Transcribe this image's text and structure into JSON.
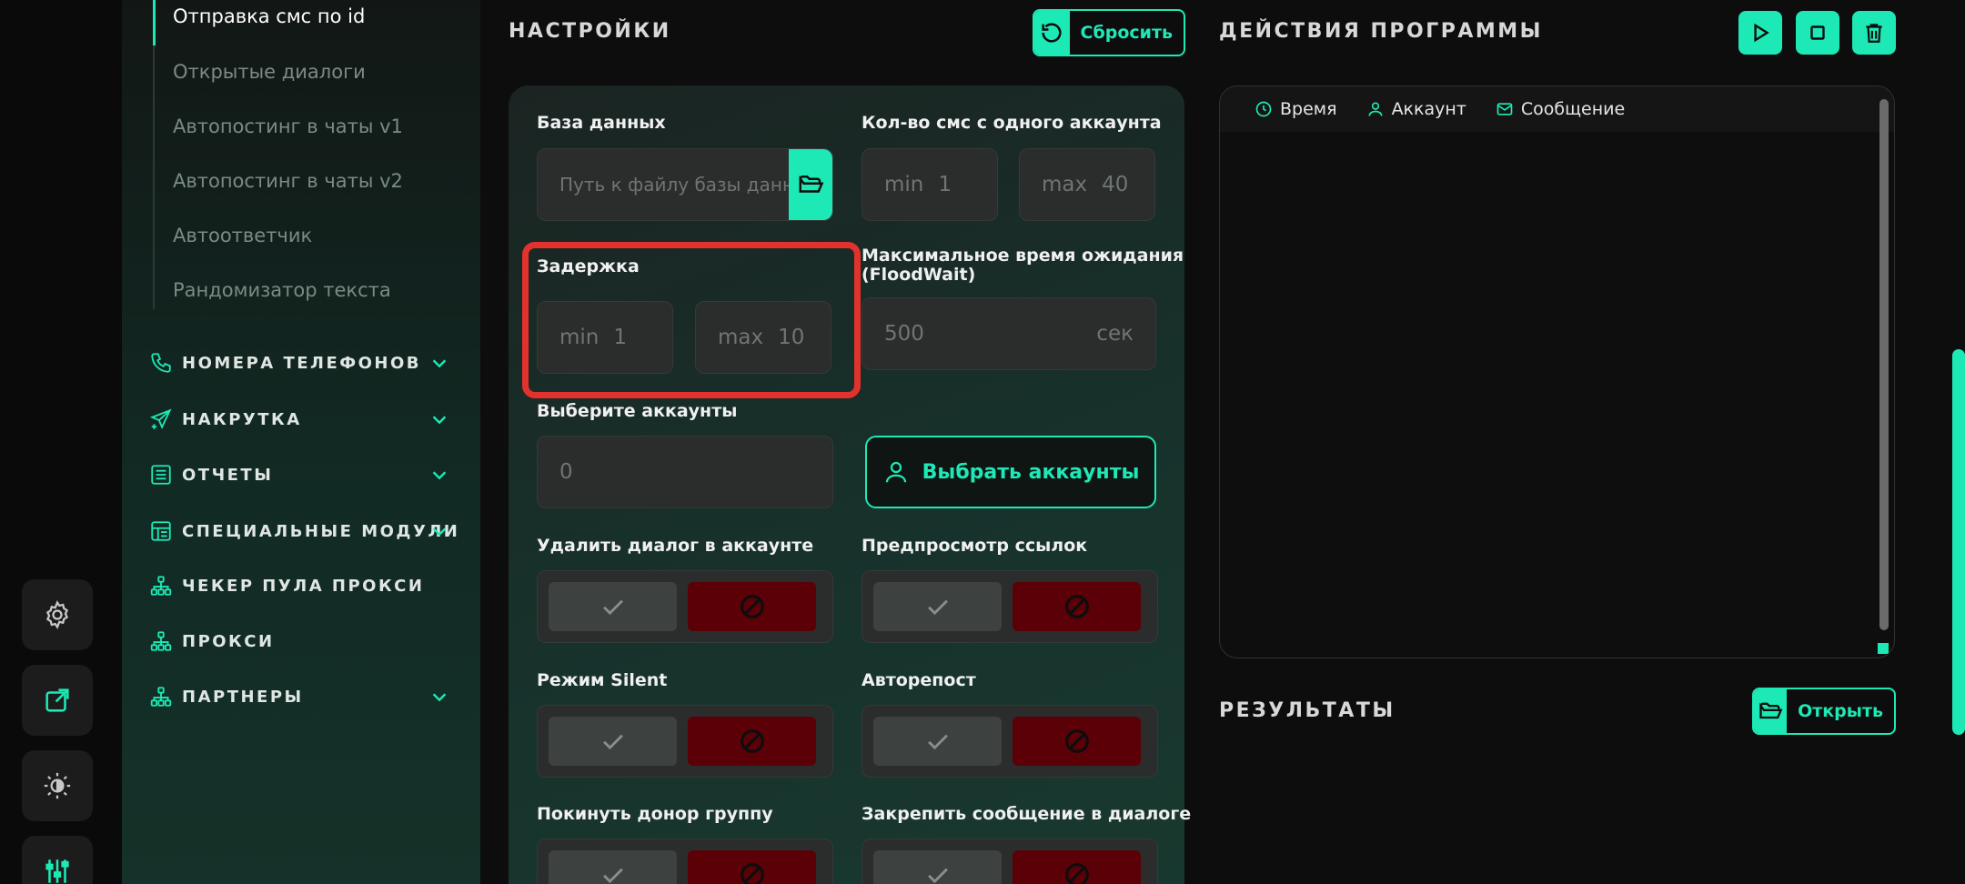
{
  "sidebar": {
    "sub_items": [
      {
        "label": "Отправка смс по id",
        "active": true
      },
      {
        "label": "Открытые диалоги"
      },
      {
        "label": "Автопостинг в чаты v1"
      },
      {
        "label": "Автопостинг в чаты v2"
      },
      {
        "label": "Автоответчик"
      },
      {
        "label": "Рандомизатор текста"
      }
    ],
    "nav": [
      {
        "label": "НОМЕРА ТЕЛЕФОНОВ",
        "icon": "phone-icon",
        "has_children": true
      },
      {
        "label": "НАКРУТКА",
        "icon": "send-plus-icon",
        "has_children": true
      },
      {
        "label": "ОТЧЕТЫ",
        "icon": "report-icon",
        "has_children": true
      },
      {
        "label": "СПЕЦИАЛЬНЫЕ МОДУЛИ",
        "icon": "modules-icon",
        "has_children": true
      },
      {
        "label": "ЧЕКЕР ПУЛА ПРОКСИ",
        "icon": "network-icon",
        "has_children": false
      },
      {
        "label": "ПРОКСИ",
        "icon": "network-icon",
        "has_children": false
      },
      {
        "label": "ПАРТНЕРЫ",
        "icon": "network-icon",
        "has_children": true
      }
    ]
  },
  "rail": {
    "buttons": [
      "gear-icon",
      "external-link-icon",
      "theme-icon",
      "sliders-icon"
    ]
  },
  "settings": {
    "title": "НАСТРОЙКИ",
    "reset_label": "Сбросить",
    "database": {
      "label": "База данных",
      "placeholder": "Путь к файлу базы данных"
    },
    "sms_per_account": {
      "label": "Кол-во смс с одного аккаунта",
      "min_label": "min",
      "min": "1",
      "max_label": "max",
      "max": "40"
    },
    "delay": {
      "label": "Задержка",
      "min_label": "min",
      "min": "1",
      "max_label": "max",
      "max": "10"
    },
    "floodwait": {
      "label_line1": "Максимальное время ожидания",
      "label_line2": "(FloodWait)",
      "value": "500",
      "unit": "сек"
    },
    "accounts": {
      "label": "Выберите аккаунты",
      "value": "0",
      "button": "Выбрать аккаунты"
    },
    "toggles": [
      {
        "label": "Удалить диалог в аккаунте"
      },
      {
        "label": "Предпросмотр ссылок"
      },
      {
        "label": "Режим Silent"
      },
      {
        "label": "Авторепост"
      },
      {
        "label": "Покинуть донор группу"
      },
      {
        "label": "Закрепить сообщение в диалоге"
      }
    ]
  },
  "actions": {
    "title": "ДЕЙСТВИЯ ПРОГРАММЫ",
    "columns": [
      "Время",
      "Аккаунт",
      "Сообщение"
    ]
  },
  "results": {
    "title": "РЕЗУЛЬТАТЫ",
    "open_label": "Открыть"
  },
  "colors": {
    "accent": "#1de9b6",
    "danger": "#5c0008",
    "highlight": "#e3322d"
  }
}
